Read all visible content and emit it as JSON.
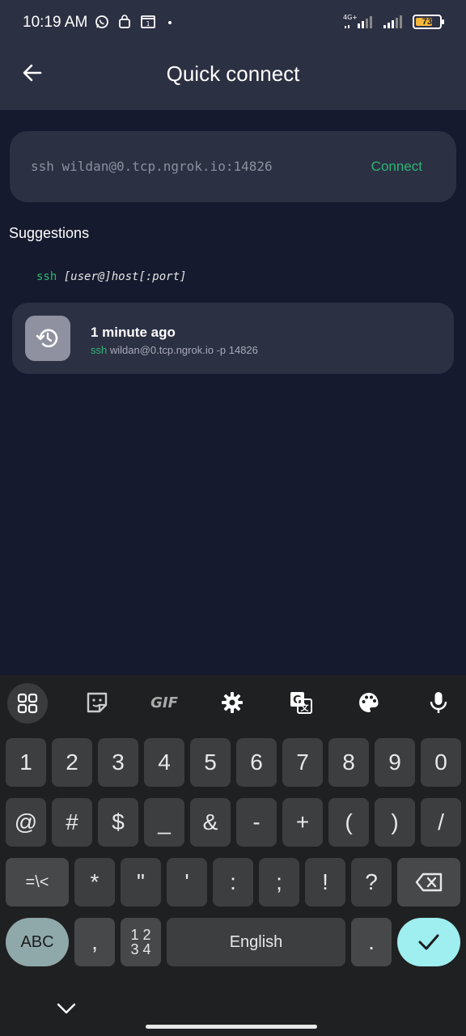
{
  "status_bar": {
    "time": "10:19 AM",
    "network": "4G+",
    "battery": "73",
    "battery_level": 0.73
  },
  "app_bar": {
    "title": "Quick connect"
  },
  "command": {
    "value": "ssh wildan@0.tcp.ngrok.io:14826",
    "connect_label": "Connect"
  },
  "suggestions": {
    "title": "Suggestions",
    "hint_cmd": "ssh",
    "hint_args": "[user@]host[:port]"
  },
  "history": {
    "title": "1 minute ago",
    "cmd": "ssh",
    "args": "wildan@0.tcp.ngrok.io -p 14826"
  },
  "keyboard": {
    "toolbar": [
      "apps-grid-icon",
      "sticker-icon",
      "GIF",
      "gear-icon",
      "translate-icon",
      "palette-icon",
      "microphone-icon"
    ],
    "row1": [
      "1",
      "2",
      "3",
      "4",
      "5",
      "6",
      "7",
      "8",
      "9",
      "0"
    ],
    "row2": [
      "@",
      "#",
      "$",
      "_",
      "&",
      "-",
      "+",
      "(",
      ")",
      "/"
    ],
    "row3": [
      "=\\<",
      "*",
      "\"",
      "'",
      ":",
      ";",
      "!",
      "?"
    ],
    "abc_label": "ABC",
    "comma": ",",
    "numpad_top": "1 2",
    "numpad_bottom": "3 4",
    "space_label": "English",
    "period": "."
  }
}
